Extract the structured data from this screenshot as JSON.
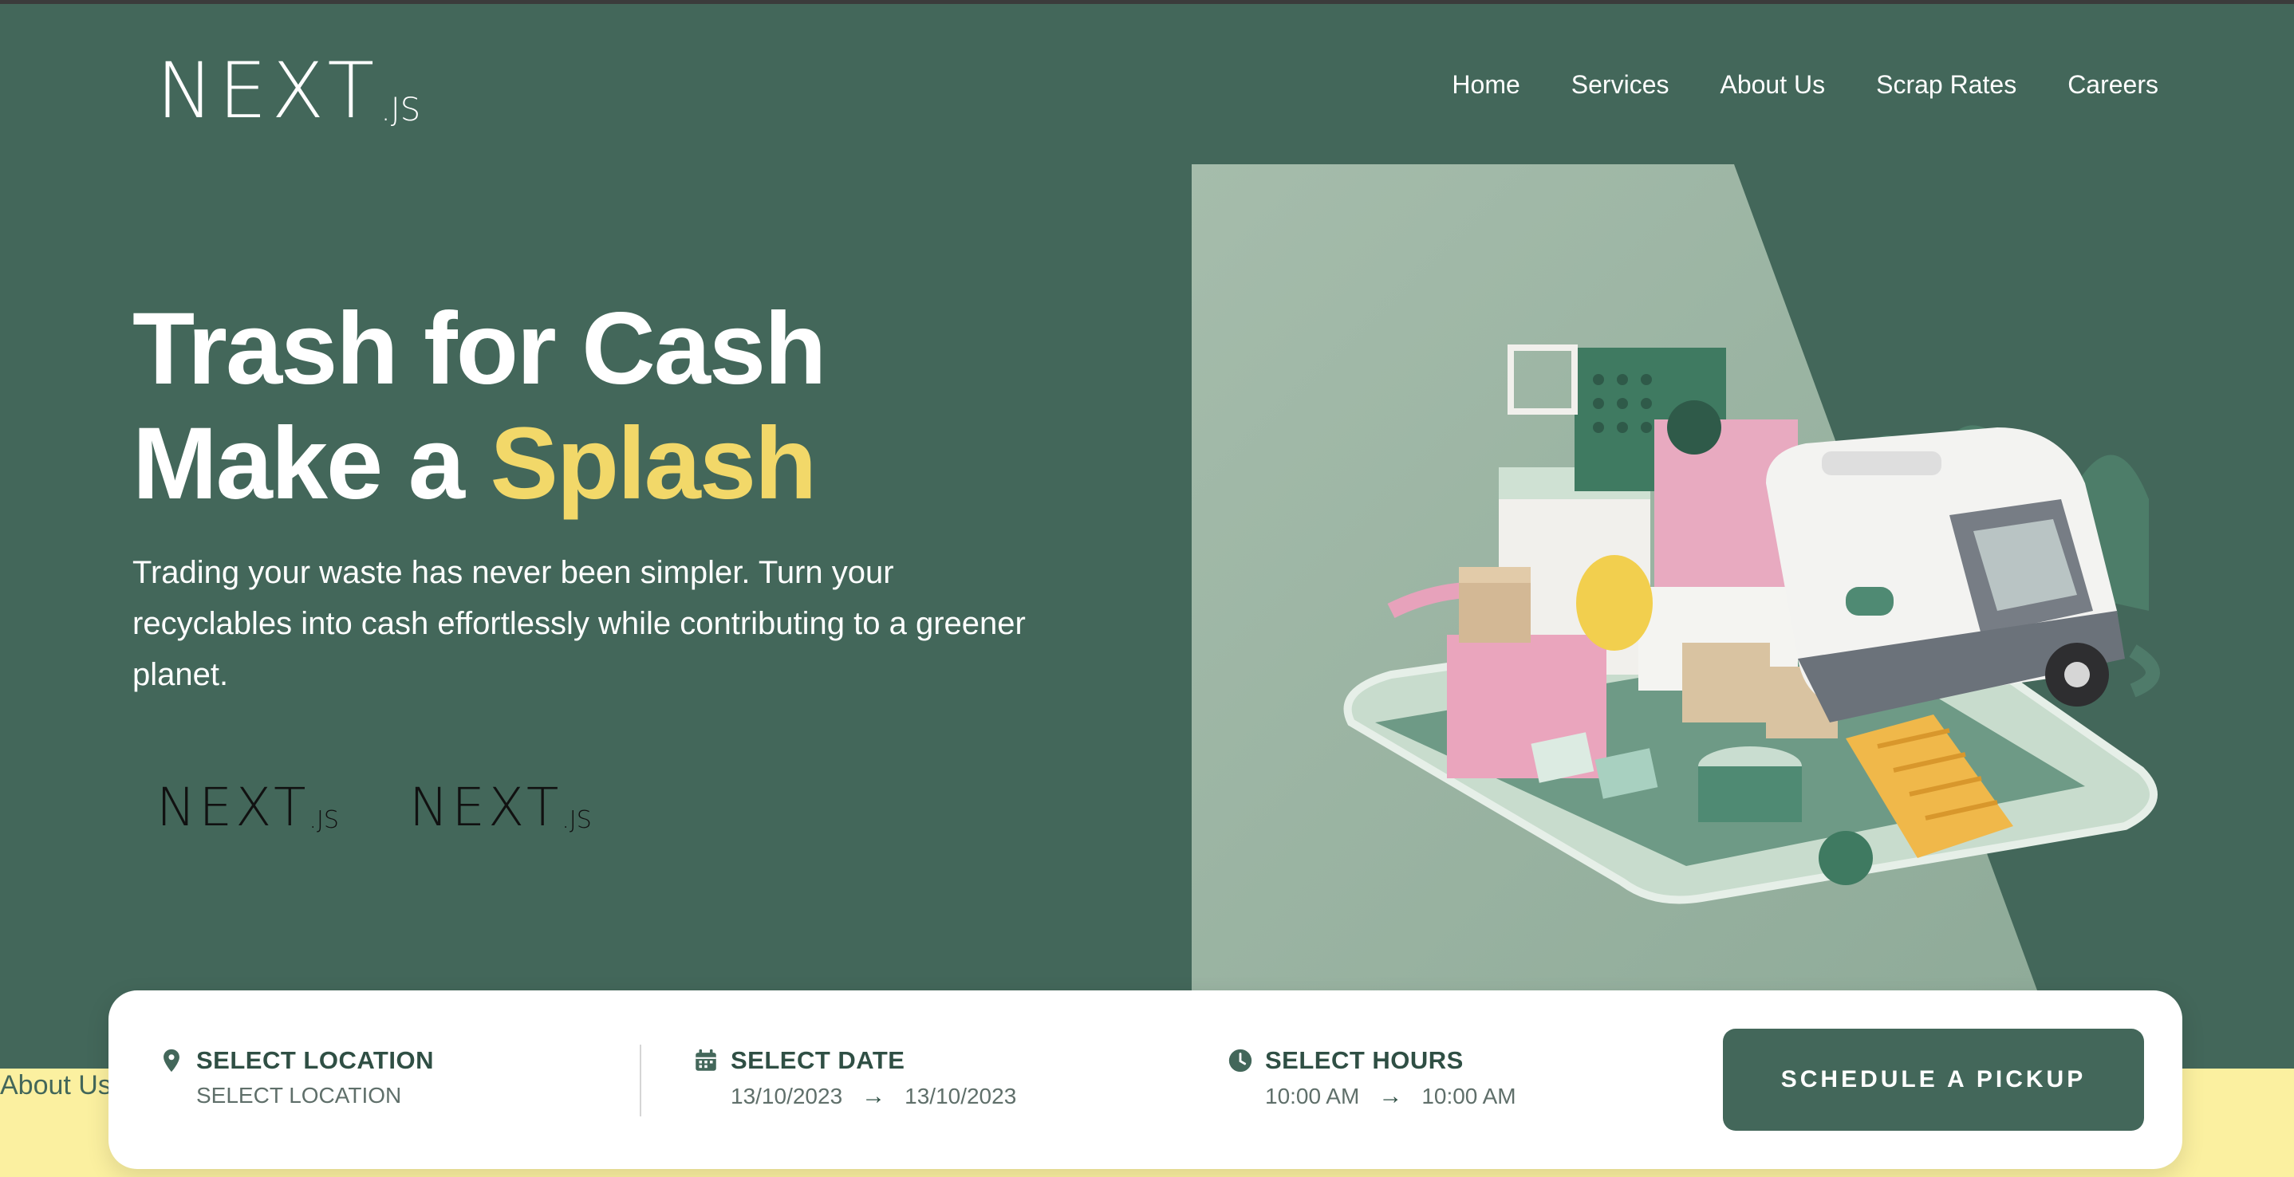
{
  "header": {
    "logo": {
      "main": "NEXT",
      "suffix": ".JS"
    },
    "nav": [
      "Home",
      "Services",
      "About Us",
      "Scrap Rates",
      "Careers"
    ]
  },
  "hero": {
    "title_line1": "Trash for Cash",
    "title_line2_prefix": "Make a ",
    "title_line2_accent": "Splash",
    "description": "Trading your waste has never been simpler. Turn your recyclables into cash effortlessly while contributing to a greener planet.",
    "partners": [
      {
        "main": "NEXT",
        "suffix": ".JS"
      },
      {
        "main": "NEXT",
        "suffix": ".JS"
      }
    ]
  },
  "footer_fragment": "About Us",
  "booking": {
    "location": {
      "label": "SELECT LOCATION",
      "value": "SELECT LOCATION",
      "icon": "map-pin-icon"
    },
    "date": {
      "label": "SELECT DATE",
      "from": "13/10/2023",
      "to": "13/10/2023",
      "icon": "calendar-icon"
    },
    "hours": {
      "label": "SELECT HOURS",
      "from": "10:00 AM",
      "to": "10:00 AM",
      "icon": "clock-icon"
    },
    "arrow": "→",
    "button": "SCHEDULE A PICKUP"
  },
  "colors": {
    "background": "#43675a",
    "accent": "#f2d869",
    "band": "#fbf0a0"
  }
}
